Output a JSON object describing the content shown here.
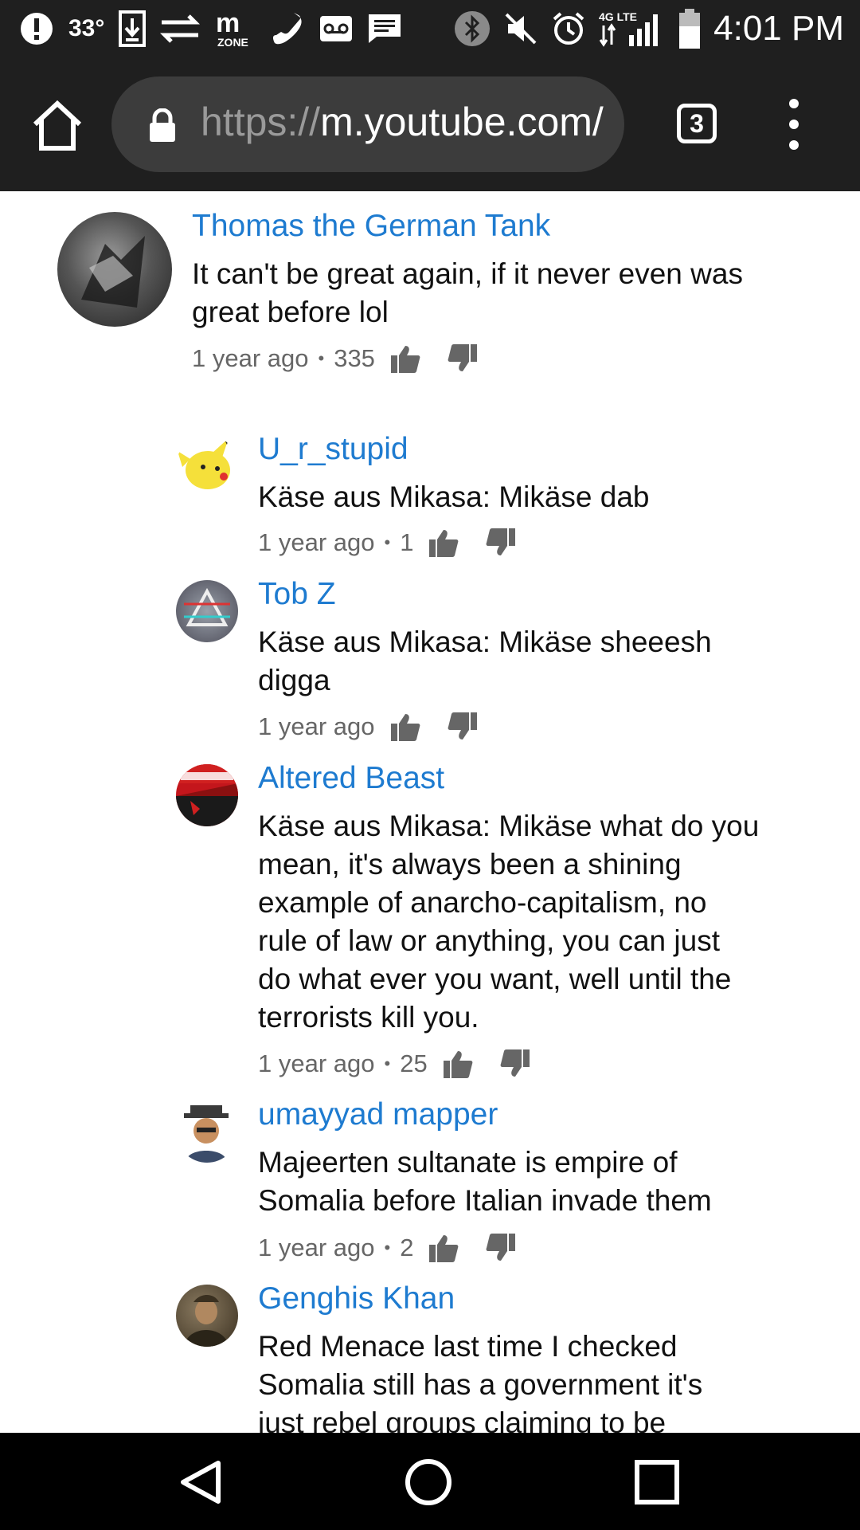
{
  "status_bar": {
    "temperature": "33°",
    "time": "4:01 PM",
    "network_label": "4G LTE",
    "icons": [
      "alert-icon",
      "download-icon",
      "data-sync-icon",
      "mzone-icon",
      "phone-icon",
      "voicemail-icon",
      "message-icon",
      "bluetooth-icon",
      "mute-icon",
      "alarm-icon",
      "signal-icon",
      "battery-icon"
    ]
  },
  "browser": {
    "url_scheme": "https://",
    "url_host": "m.youtube.com/",
    "tab_count": "3"
  },
  "comments": [
    {
      "author": "Thomas the German Tank",
      "lines": [
        "It can't be great again, if it never even was",
        "great before lol"
      ],
      "age": "1 year ago",
      "likes": "335",
      "avatar_color": "#444444"
    },
    {
      "author": "U_r_stupid",
      "lines": [
        "Käse aus Mikasa: Mikäse dab"
      ],
      "age": "1 year ago",
      "likes": "1",
      "avatar_color": "#f5e03a"
    },
    {
      "author": "Tob Z",
      "lines": [
        "Käse aus Mikasa: Mikäse sheeesh",
        "digga"
      ],
      "age": "1 year ago",
      "likes": "",
      "avatar_color": "#6b6b78"
    },
    {
      "author": "Altered Beast",
      "lines": [
        "Käse aus Mikasa: Mikäse what do you",
        "mean, it's always been a shining",
        "example of anarcho-capitalism, no",
        "rule of law or anything, you can just",
        "do what ever you want, well until the",
        "terrorists kill you."
      ],
      "age": "1 year ago",
      "likes": "25",
      "avatar_color": "#c4161c"
    },
    {
      "author": "umayyad mapper",
      "lines": [
        "Majeerten sultanate is empire of",
        "Somalia before Italian invade them"
      ],
      "age": "1 year ago",
      "likes": "2",
      "avatar_color": "#ffffff"
    },
    {
      "author": "Genghis Khan",
      "lines": [
        "Red Menace last time I checked",
        "Somalia still has a government it's",
        "just rebel groups claiming to be"
      ],
      "age": "",
      "likes": "",
      "avatar_color": "#5a5040"
    }
  ]
}
